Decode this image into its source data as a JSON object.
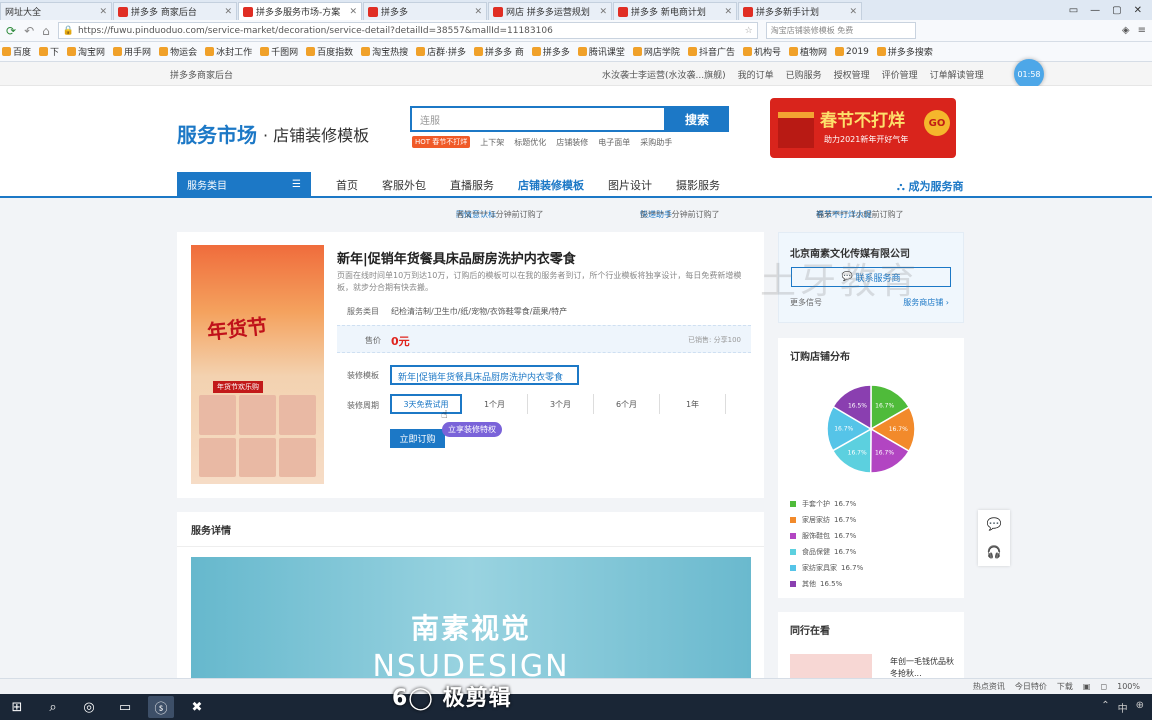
{
  "browser": {
    "tabs": [
      {
        "label": "网址大全",
        "active": false
      },
      {
        "label": "拼多多 商家后台",
        "active": false
      },
      {
        "label": "拼多多服务市场-方案",
        "active": true
      },
      {
        "label": "拼多多",
        "active": false
      },
      {
        "label": "网店 拼多多运营规划",
        "active": false
      },
      {
        "label": "拼多多 新电商计划",
        "active": false
      },
      {
        "label": "拼多多新手计划",
        "active": false
      }
    ],
    "window_buttons": [
      "▭",
      "—",
      "▢",
      "✕"
    ],
    "url": "https://fuwu.pinduoduo.com/service-market/decoration/service-detail?detailId=38557&mallId=11183106",
    "side_search": "淘宝店铺装修模板 免费",
    "bookmarks": [
      "百度",
      "下",
      "淘宝网",
      "用手网",
      "物运会",
      "冰封工作",
      "千图网",
      "百度指数",
      "淘宝热搜",
      "店群·拼多",
      "拼多多 商",
      "拼多多",
      "腾讯课堂",
      "网店学院",
      "抖音广告",
      "机构号",
      "植物网",
      "2019",
      "拼多多搜索"
    ]
  },
  "topstrip": {
    "left": "拼多多商家后台",
    "links": [
      "水汝袭士李运营(水汝袭...旗舰)",
      "我的订单",
      "已购服务",
      "授权管理",
      "评价管理",
      "订单解读管理"
    ]
  },
  "clock": "01:58",
  "header": {
    "logo": "服务市场",
    "logo_sub": "· 店铺装修模板",
    "search_placeholder": "连服",
    "search_button": "搜索",
    "hot_tag": "HOT",
    "hot_highlight": "春节不打烊",
    "hot_links": [
      "上下架",
      "标题优化",
      "店铺装修",
      "电子面单",
      "采购助手"
    ],
    "banner_title": "春节不打烊",
    "banner_sub": "助力2021新年开好气年",
    "banner_go": "GO"
  },
  "nav": {
    "category_button": "服务类目",
    "links": [
      "首页",
      "客服外包",
      "直播服务",
      "店铺装修模板",
      "图片设计",
      "摄影服务"
    ],
    "active_index": 3,
    "become_provider": "成为服务商"
  },
  "ticker": [
    {
      "text": "者又**** 1分钟前订购了",
      "link": "同情意认标"
    },
    {
      "text": "彭**** 1分钟前订购了",
      "link": "快递助手"
    },
    {
      "text": "福米**** 1小时前订购了",
      "link": "春节不打烊大促"
    }
  ],
  "product": {
    "title": "新年|促销年货餐具床品厨房洗护内衣零食",
    "description": "页面在线时间单10万到达10万，订购后的模板可以在我的服务者到订，所个行业模板将独享设计，每日免费新增模板，就步分合期有快去搬。",
    "image_title": "年货节",
    "image_tag": "年货节欢乐购",
    "category_label": "服务类目",
    "category_value": "纪检清洁制/卫生巾/纸/宠物/衣饰鞋零食/蔬果/特产",
    "price_label": "售价",
    "price_value": "0元",
    "price_right": "已销售: 分享100",
    "template_label": "装修模板",
    "template_value": "新年|促销年货餐具床品厨房洗护内衣零食",
    "duration_label": "装修周期",
    "duration_options": [
      "3天免费试用",
      "1个月",
      "3个月",
      "6个月",
      "1年"
    ],
    "duration_selected": 0,
    "duration_tip": "立享装修特权",
    "buy_button": "立即订购"
  },
  "provider": {
    "name": "北京南素文化传媒有限公司",
    "contact_button": "联系服务商",
    "more_label": "更多信号",
    "shop_link": "服务商店铺 ›"
  },
  "watermark": "土牙教育",
  "distribution": {
    "title": "订购店铺分布",
    "legend": [
      {
        "name": "手套个护",
        "pct": "16.7%",
        "color": "#4fbb3a"
      },
      {
        "name": "家居家纺",
        "pct": "16.7%",
        "color": "#f28a2b"
      },
      {
        "name": "服饰鞋包",
        "pct": "16.7%",
        "color": "#b245c2"
      },
      {
        "name": "食品保健",
        "pct": "16.7%",
        "color": "#5cd0df"
      },
      {
        "name": "家纺家具家",
        "pct": "16.7%",
        "color": "#55c4e8"
      },
      {
        "name": "其他",
        "pct": "16.5%",
        "color": "#8a3fb0"
      }
    ]
  },
  "peers": {
    "title": "同行在看",
    "item_text": "年创一毛钱优品秋冬抢秋..."
  },
  "detail": {
    "title": "服务详情",
    "banner_line1": "南素视觉",
    "banner_line2": "NSUDESIGN"
  },
  "statusbar": [
    "热点资讯",
    "今日特价",
    "下载",
    "▣",
    "◻",
    "100%"
  ],
  "taskbar_logo": "6◯ 极剪辑",
  "taskbar_right": [
    "⌃",
    "中",
    "⊕"
  ]
}
